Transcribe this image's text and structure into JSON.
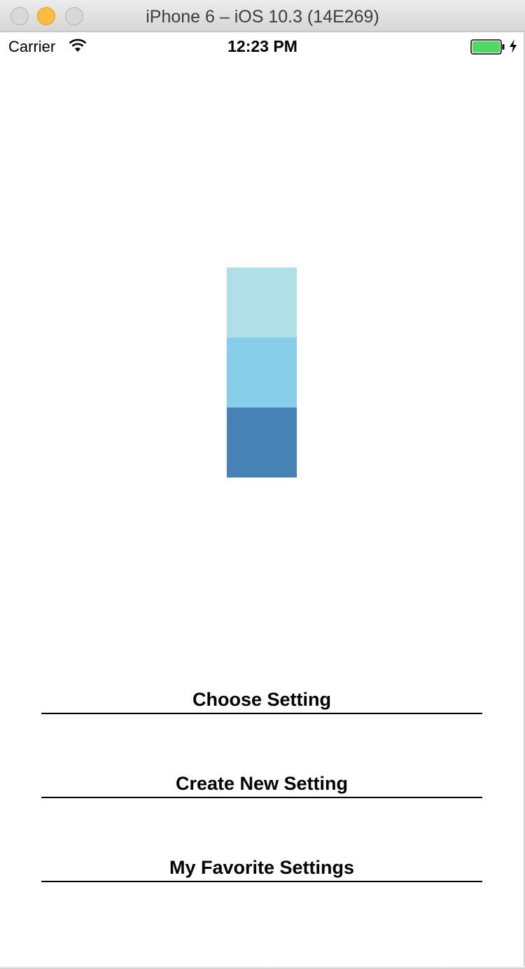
{
  "window": {
    "title": "iPhone 6 – iOS 10.3 (14E269)"
  },
  "status_bar": {
    "carrier": "Carrier",
    "time": "12:23 PM",
    "battery_color": "#4cd964"
  },
  "swatches": [
    {
      "color": "#b0e0e6"
    },
    {
      "color": "#87ceeb"
    },
    {
      "color": "#4682b4"
    }
  ],
  "menu": {
    "choose_setting": "Choose Setting",
    "create_new_setting": "Create New Setting",
    "my_favorite_settings": "My Favorite Settings"
  }
}
